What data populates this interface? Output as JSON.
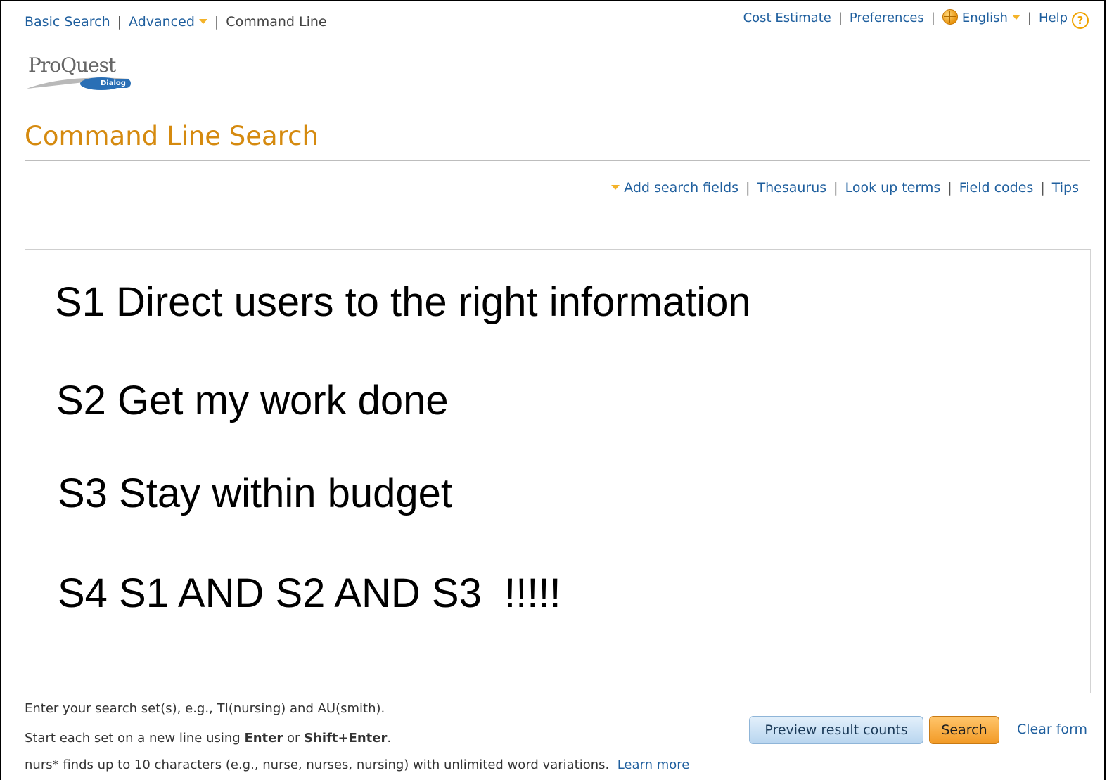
{
  "top_nav": {
    "basic_search": "Basic Search",
    "advanced": "Advanced",
    "command_line": "Command Line"
  },
  "utility_nav": {
    "cost_estimate": "Cost Estimate",
    "preferences": "Preferences",
    "language": "English",
    "help": "Help",
    "help_symbol": "?"
  },
  "logo": {
    "name": "ProQuest",
    "sub": "Dialog"
  },
  "page": {
    "title": "Command Line Search"
  },
  "tools": {
    "add_fields": "Add search fields",
    "thesaurus": "Thesaurus",
    "look_up_terms": "Look up terms",
    "field_codes": "Field codes",
    "tips": "Tips"
  },
  "search_box": {
    "lines": [
      "S1 Direct users to the right information",
      "S2 Get my work done",
      "S3 Stay within budget",
      "S4 S1 AND S2 AND S3  !!!!!"
    ]
  },
  "hints": {
    "line1": "Enter your search set(s), e.g., TI(nursing) and AU(smith).",
    "line2_prefix": "Start each set on a new line using ",
    "line2_enter": "Enter",
    "line2_or": " or ",
    "line2_shift": "Shift+Enter",
    "line2_suffix": ".",
    "line3": "nurs* finds up to 10 characters (e.g., nurse, nurses, nursing) with unlimited word variations.",
    "learn_more": "Learn more"
  },
  "actions": {
    "preview": "Preview result counts",
    "search": "Search",
    "clear": "Clear form"
  },
  "colors": {
    "link": "#1f5f9e",
    "title": "#d58a0f",
    "accent_caret": "#f4b329"
  },
  "icons": {
    "caret": "caret-down-icon",
    "globe": "globe-icon",
    "help": "help-circle-icon"
  }
}
